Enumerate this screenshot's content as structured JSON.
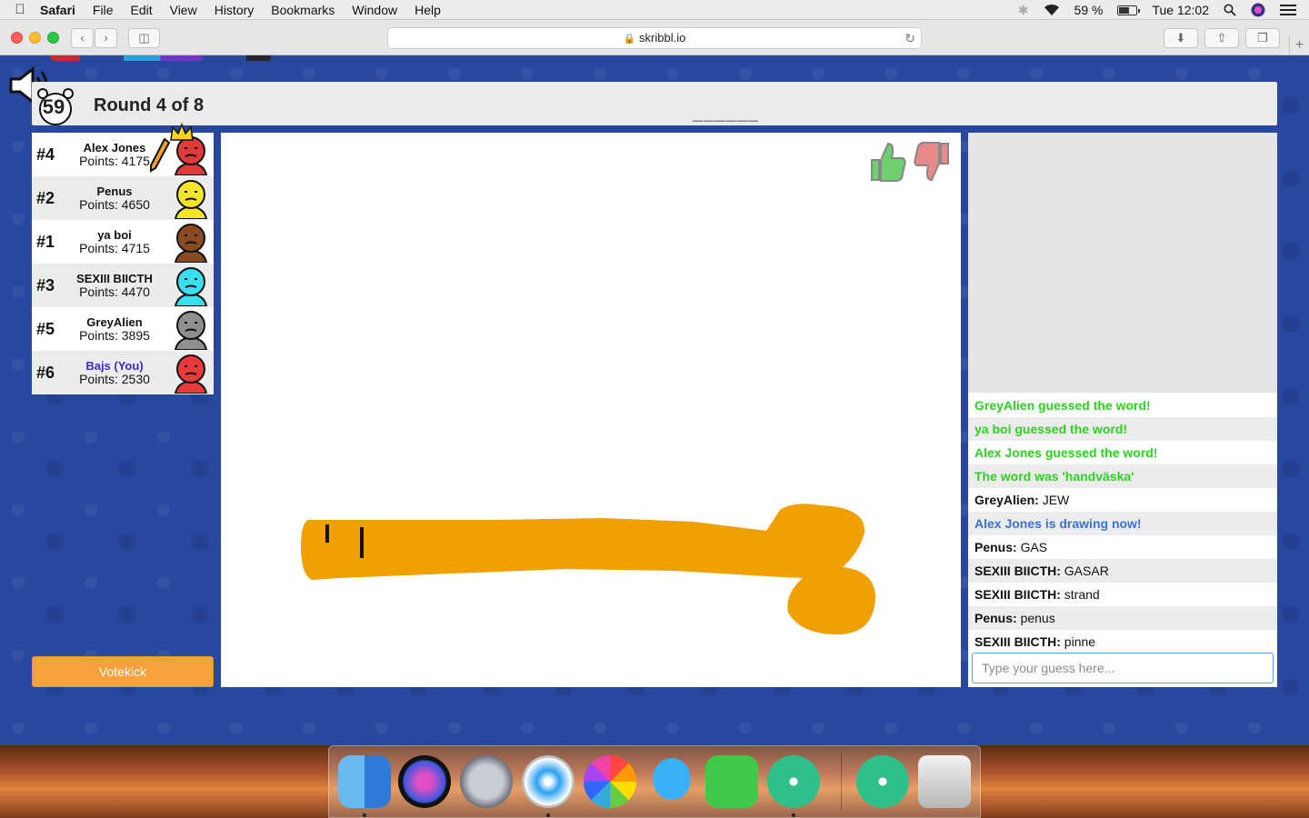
{
  "menubar": {
    "app": "Safari",
    "items": [
      "File",
      "Edit",
      "View",
      "History",
      "Bookmarks",
      "Window",
      "Help"
    ],
    "battery_text": "59 %",
    "battery_level": 0.59,
    "clock": "Tue 12:02"
  },
  "browser": {
    "url": "skribbl.io"
  },
  "game": {
    "timer": "59",
    "round": "Round 4 of 8",
    "word_hint": "______"
  },
  "players": [
    {
      "rank": "#4",
      "name": "Alex Jones",
      "points": "Points: 4175",
      "color": "#e03a3a",
      "drawing": true
    },
    {
      "rank": "#2",
      "name": "Penus",
      "points": "Points: 4650",
      "color": "#f5e52a"
    },
    {
      "rank": "#1",
      "name": "ya boi",
      "points": "Points: 4715",
      "color": "#8a4a22"
    },
    {
      "rank": "#3",
      "name": "SEXIII BIICTH",
      "points": "Points: 4470",
      "color": "#36e0f0"
    },
    {
      "rank": "#5",
      "name": "GreyAlien",
      "points": "Points: 3895",
      "color": "#8f8f8f"
    },
    {
      "rank": "#6",
      "name": "Bajs (You)",
      "points": "Points: 2530",
      "color": "#e83a3a",
      "you": true
    }
  ],
  "votekick_label": "Votekick",
  "chat": {
    "messages": [
      {
        "type": "system-green",
        "text": "GreyAlien guessed the word!"
      },
      {
        "type": "system-green",
        "text": "ya boi guessed the word!"
      },
      {
        "type": "system-green",
        "text": "Alex Jones guessed the word!"
      },
      {
        "type": "system-green",
        "text": "The word was 'handväska'"
      },
      {
        "type": "user",
        "user": "GreyAlien:",
        "text": " JEW"
      },
      {
        "type": "system-blue",
        "text": "Alex Jones is drawing now!"
      },
      {
        "type": "user",
        "user": "Penus:",
        "text": " GAS"
      },
      {
        "type": "user",
        "user": "SEXIII BIICTH:",
        "text": " GASAR"
      },
      {
        "type": "user",
        "user": "SEXIII BIICTH:",
        "text": " strand"
      },
      {
        "type": "user",
        "user": "Penus:",
        "text": " penus"
      },
      {
        "type": "user",
        "user": "SEXIII BIICTH:",
        "text": " pinne"
      }
    ],
    "input_placeholder": "Type your guess here..."
  },
  "colors": {
    "accent_green": "#2bd31f",
    "accent_blue": "#3972d6",
    "votekick": "#f5a23e",
    "drawing_orange": "#f0a000"
  },
  "dock": [
    "finder-icon",
    "siri-icon",
    "launchpad-icon",
    "safari-icon",
    "photos-icon",
    "messages-icon",
    "facetime-icon",
    "atom-icon",
    "atom-icon",
    "trash-icon"
  ]
}
